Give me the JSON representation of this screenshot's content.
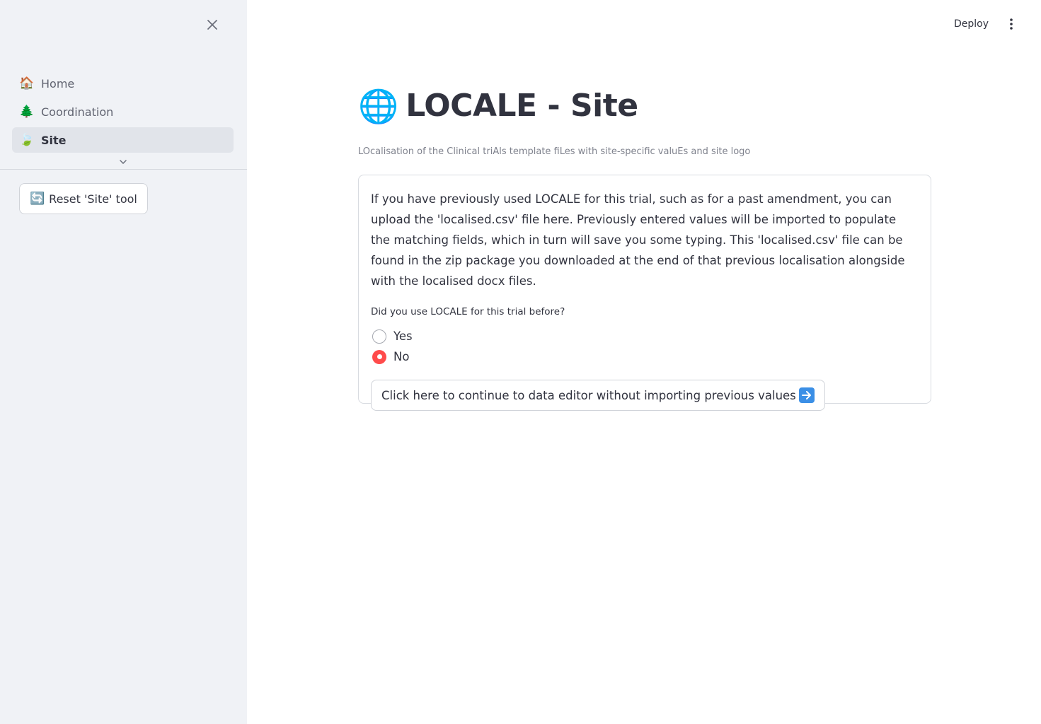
{
  "sidebar": {
    "items": [
      {
        "emoji": "🏠",
        "icon": "house-icon",
        "label": "Home",
        "active": false
      },
      {
        "emoji": "🌲",
        "icon": "tree-icon",
        "label": "Coordination",
        "active": false
      },
      {
        "emoji": "🍃",
        "icon": "leaf-icon",
        "label": "Site",
        "active": true
      }
    ],
    "reset_emoji": "🔄",
    "reset_label": "Reset 'Site' tool"
  },
  "header": {
    "deploy_label": "Deploy"
  },
  "main": {
    "title_emoji": "🌐",
    "title": "LOCALE - Site",
    "caption": "LOcalisation of the Clinical triAls template fiLes with site-specific valuEs and site logo",
    "intro": "If you have previously used LOCALE for this trial, such as for a past amendment, you can upload the 'localised.csv' file here. Previously entered values will be imported to populate the matching fields, which in turn will save you some typing. This 'localised.csv' file can be found in the zip package you downloaded at the end of that previous localisation alongside with the localised docx files.",
    "radio_question": "Did you use LOCALE for this trial before?",
    "radio_options": [
      {
        "label": "Yes",
        "checked": false
      },
      {
        "label": "No",
        "checked": true
      }
    ],
    "continue_label": "Click here to continue to data editor without importing previous values"
  },
  "colors": {
    "sidebar_bg": "#f0f2f6",
    "accent": "#ff4b4b",
    "text": "#31333f"
  }
}
